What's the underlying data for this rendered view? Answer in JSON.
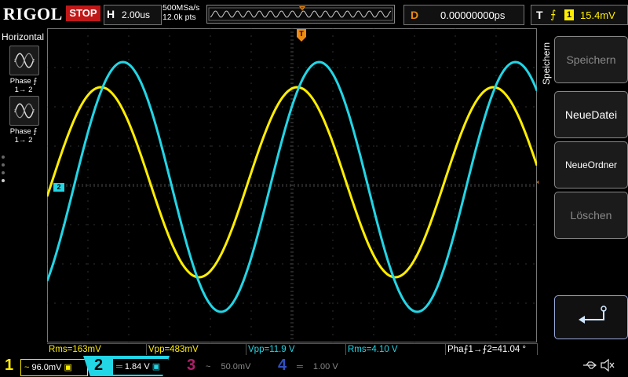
{
  "topbar": {
    "logo": "RIGOL",
    "run_state": "STOP",
    "horizontal_key": "H",
    "timebase": "2.00us",
    "sample_rate": "500MSa/s",
    "memory_depth": "12.0k pts",
    "delay_key": "D",
    "delay_value": "0.00000000ps",
    "trigger_key": "T",
    "trigger_channel": "1",
    "trigger_level": "15.4mV"
  },
  "left_panel": {
    "title": "Horizontal",
    "buttons": [
      {
        "label_line1": "Phase ⨍",
        "label_line2": "1→ 2"
      },
      {
        "label_line1": "Phase ⨍",
        "label_line2": "1→ 2"
      }
    ]
  },
  "markers": {
    "ch2_ground": "2"
  },
  "right_menu": {
    "title": "Speichern",
    "items": [
      {
        "label": "Speichern",
        "enabled": false
      },
      {
        "label": "NeueDatei",
        "enabled": true
      },
      {
        "label": "NeueOrdner",
        "enabled": true
      },
      {
        "label": "Löschen",
        "enabled": false
      }
    ]
  },
  "measurements": [
    {
      "text": "Rms=163mV",
      "color": "#ffee00"
    },
    {
      "text": "Vpp=483mV",
      "color": "#ffee00"
    },
    {
      "text": "Vpp=11.9 V",
      "color": "#22d6e6"
    },
    {
      "text": "Rms=4.10 V",
      "color": "#22d6e6"
    },
    {
      "text": "Pha⨍1→⨍2=41.04 °",
      "color": "#ffffff"
    }
  ],
  "channels": [
    {
      "num": "1",
      "coupling": "~",
      "scale": "96.0mV",
      "color": "#ffee00",
      "active": true
    },
    {
      "num": "2",
      "coupling": "═",
      "scale": "1.84 V",
      "color": "#22d6e6",
      "active": true
    },
    {
      "num": "3",
      "coupling": "~",
      "scale": "50.0mV",
      "color": "#b0206a",
      "active": false
    },
    {
      "num": "4",
      "coupling": "═",
      "scale": "1.00 V",
      "color": "#3050c0",
      "active": false
    }
  ],
  "colors": {
    "ch1": "#ffee00",
    "ch2": "#22d6e6",
    "trigger": "#f08a10",
    "stop": "#c01818"
  }
}
